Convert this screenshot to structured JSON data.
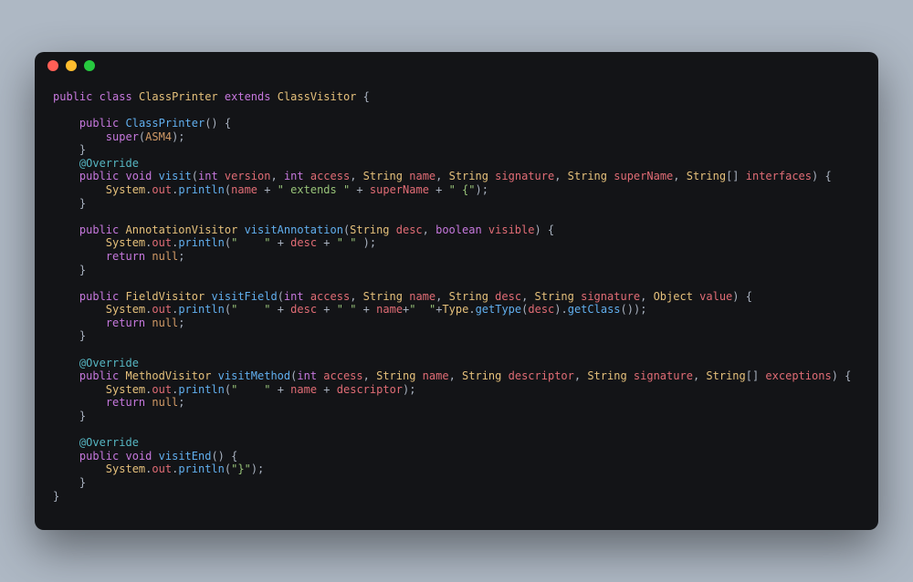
{
  "window": {
    "traffic_lights": [
      "close",
      "minimize",
      "zoom"
    ]
  },
  "colors": {
    "background": "#131417",
    "keyword": "#c678dd",
    "type": "#e5c07b",
    "method": "#61afef",
    "field": "#e06c75",
    "constant": "#d19a66",
    "string": "#98c379",
    "annotation": "#56b6c2"
  },
  "language": "java",
  "code": {
    "class_decl": {
      "kw_public": "public",
      "kw_class": "class",
      "name": "ClassPrinter",
      "kw_extends": "extends",
      "super": "ClassVisitor",
      "open": " {"
    },
    "ctor": {
      "kw_public": "public",
      "name": "ClassPrinter",
      "parens": "() {",
      "super_call": {
        "kw_super": "super",
        "open": "(",
        "arg": "ASM4",
        "close": ");"
      },
      "close": "}"
    },
    "override1": "@Override",
    "visit": {
      "sig": {
        "kw_public": "public",
        "kw_void": "void",
        "name": "visit",
        "open": "(",
        "p1t": "int",
        "p1n": " version",
        "c1": ", ",
        "p2t": "int",
        "p2n": " access",
        "c2": ", ",
        "p3t": "String",
        "p3n": " name",
        "c3": ", ",
        "p4t": "String",
        "p4n": " signature",
        "c4": ", ",
        "p5t": "String",
        "p5n": " superName",
        "c5": ", ",
        "p6t": "String",
        "p6arr": "[]",
        "p6n": " interfaces",
        "close": ") {"
      },
      "body": {
        "sys": "System",
        "dot1": ".",
        "out": "out",
        "dot2": ".",
        "println": "println",
        "open": "(",
        "a1": "name",
        "plus1": " + ",
        "s1": "\" extends \"",
        "plus2": " + ",
        "a2": "superName",
        "plus3": " + ",
        "s2": "\" {\"",
        "close": ");"
      },
      "close": "}"
    },
    "visitAnnotation": {
      "sig": {
        "kw_public": "public",
        "ret": "AnnotationVisitor",
        "name": "visitAnnotation",
        "open": "(",
        "p1t": "String",
        "p1n": " desc",
        "c1": ", ",
        "p2t": "boolean",
        "p2n": " visible",
        "close": ") {"
      },
      "body": {
        "sys": "System",
        "dot1": ".",
        "out": "out",
        "dot2": ".",
        "println": "println",
        "open": "(",
        "s1": "\"    \"",
        "plus1": " + ",
        "a1": "desc",
        "plus2": " + ",
        "s2": "\" \"",
        "close": " );"
      },
      "ret": {
        "kw_return": "return",
        "val": " null",
        "semi": ";"
      },
      "close": "}"
    },
    "visitField": {
      "sig": {
        "kw_public": "public",
        "ret": "FieldVisitor",
        "name": "visitField",
        "open": "(",
        "p1t": "int",
        "p1n": " access",
        "c1": ", ",
        "p2t": "String",
        "p2n": " name",
        "c2": ", ",
        "p3t": "String",
        "p3n": " desc",
        "c3": ", ",
        "p4t": "String",
        "p4n": " signature",
        "c4": ", ",
        "p5t": "Object",
        "p5n": " value",
        "close": ") {"
      },
      "body": {
        "sys": "System",
        "dot1": ".",
        "out": "out",
        "dot2": ".",
        "println": "println",
        "open": "(",
        "s1": "\"    \"",
        "plus1": " + ",
        "a1": "desc",
        "plus2": " + ",
        "s2": "\" \"",
        "plus3": " + ",
        "a2": "name",
        "plus4": "+",
        "s3": "\"  \"",
        "plus5": "+",
        "type": "Type",
        "dot3": ".",
        "m1": "getType",
        "o2": "(",
        "a3": "desc",
        "c2r": ").",
        "m2": "getClass",
        "tail": "());"
      },
      "ret": {
        "kw_return": "return",
        "val": " null",
        "semi": ";"
      },
      "close": "}"
    },
    "override2": "@Override",
    "visitMethod": {
      "sig": {
        "kw_public": "public",
        "ret": "MethodVisitor",
        "name": "visitMethod",
        "open": "(",
        "p1t": "int",
        "p1n": " access",
        "c1": ", ",
        "p2t": "String",
        "p2n": " name",
        "c2": ", ",
        "p3t": "String",
        "p3n": " descriptor",
        "c3": ", ",
        "p4t": "String",
        "p4n": " signature",
        "c4": ", ",
        "p5t": "String",
        "p5arr": "[]",
        "p5n": " exceptions",
        "close": ") {"
      },
      "body": {
        "sys": "System",
        "dot1": ".",
        "out": "out",
        "dot2": ".",
        "println": "println",
        "open": "(",
        "s1": "\"    \"",
        "plus1": " + ",
        "a1": "name",
        "plus2": " + ",
        "a2": "descriptor",
        "close": ");"
      },
      "ret": {
        "kw_return": "return",
        "val": " null",
        "semi": ";"
      },
      "close": "}"
    },
    "override3": "@Override",
    "visitEnd": {
      "sig": {
        "kw_public": "public",
        "kw_void": "void",
        "name": "visitEnd",
        "parens": "() {"
      },
      "body": {
        "sys": "System",
        "dot1": ".",
        "out": "out",
        "dot2": ".",
        "println": "println",
        "open": "(",
        "s1": "\"}\"",
        "close": ");"
      },
      "close": "}"
    },
    "class_close": "}"
  }
}
